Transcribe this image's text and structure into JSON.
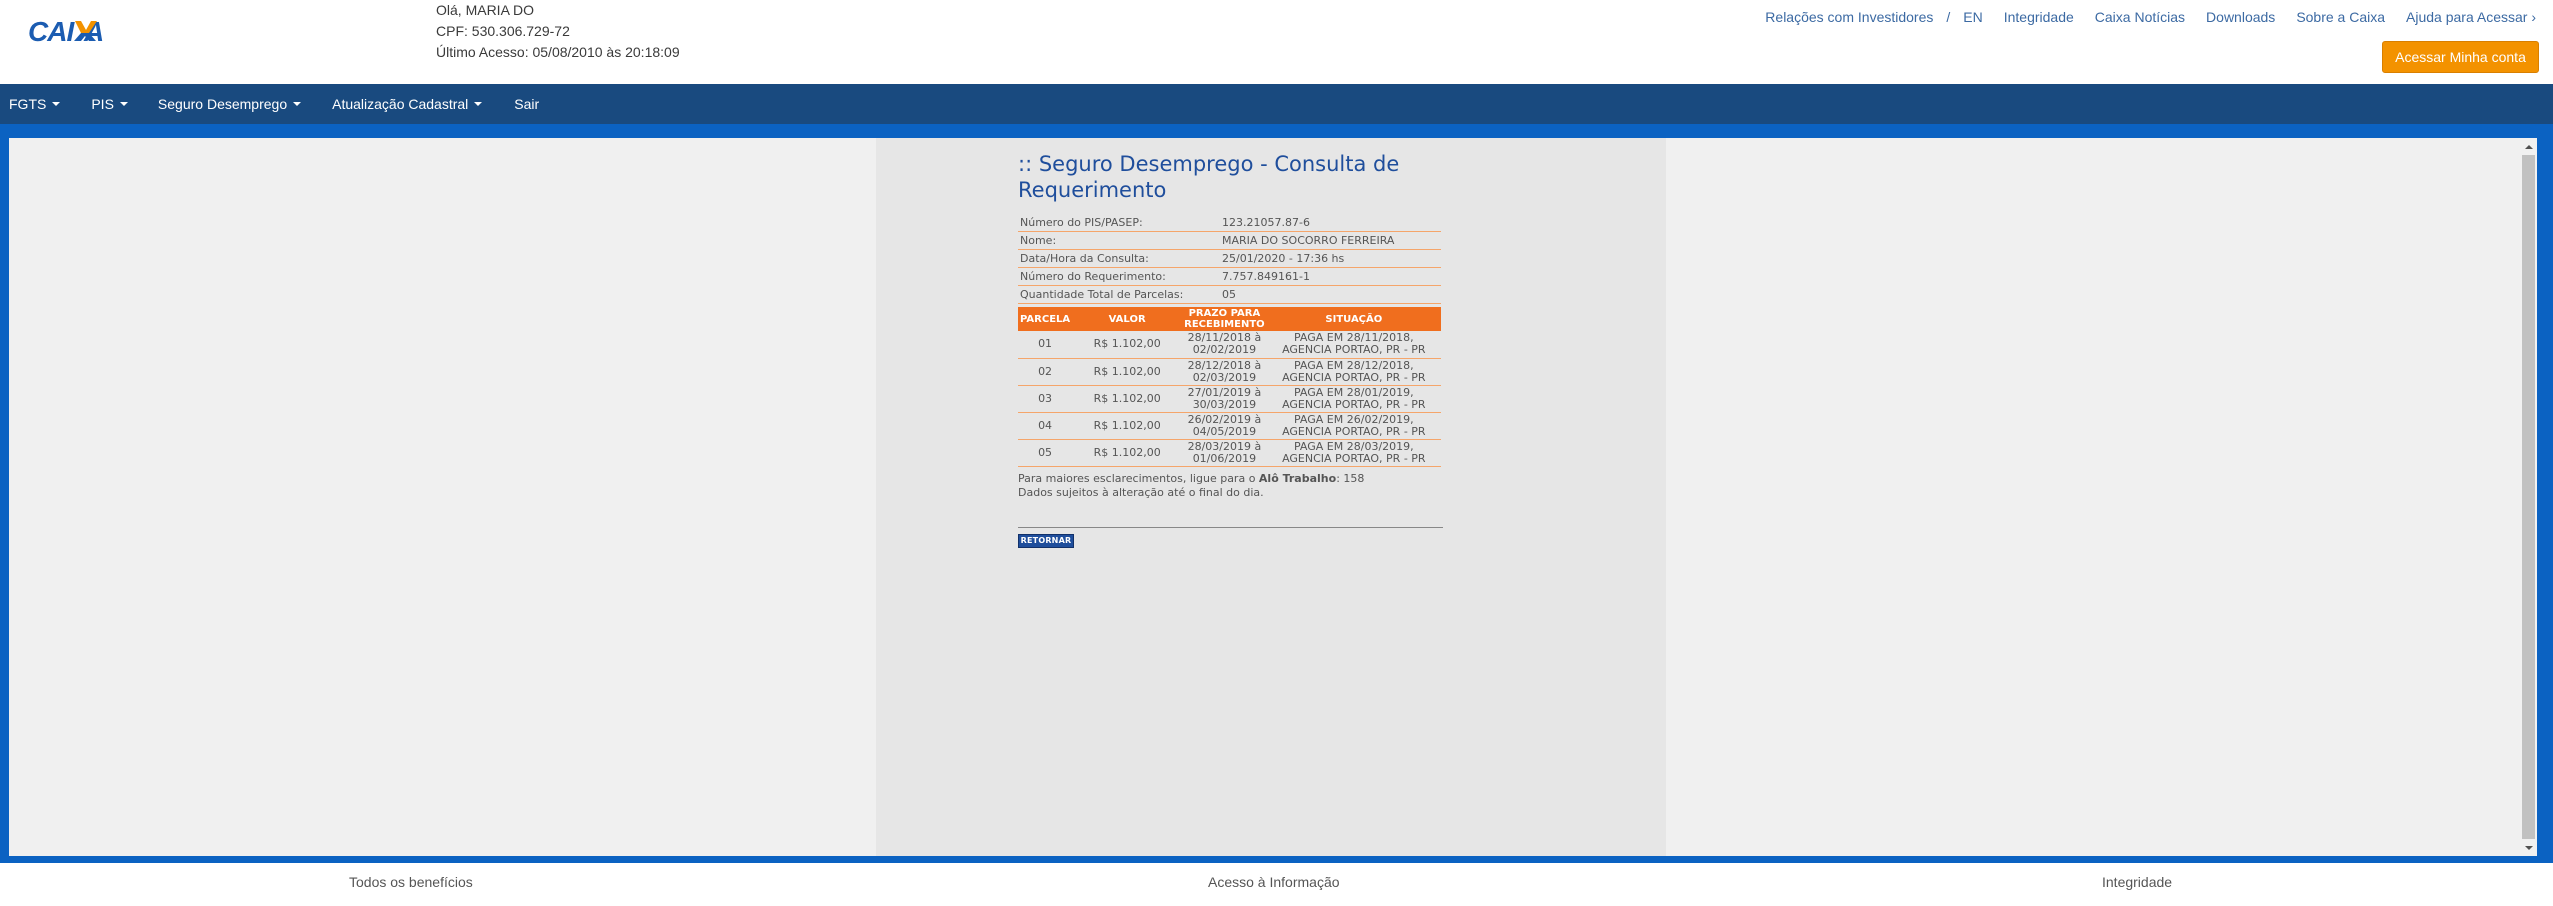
{
  "header": {
    "logo_text": "CAIXA",
    "greeting": "Olá, MARIA DO",
    "cpf": "CPF: 530.306.729-72",
    "last_access": "Último Acesso: 05/08/2010 às 20:18:09",
    "links": [
      {
        "label": "Relações com Investidores"
      },
      {
        "label": "EN"
      },
      {
        "label": "Integridade"
      },
      {
        "label": "Caixa Notícias"
      },
      {
        "label": "Downloads"
      },
      {
        "label": "Sobre a Caixa"
      },
      {
        "label": "Ajuda para Acessar ›"
      }
    ],
    "link_separator": "/",
    "access_button": "Acessar Minha conta"
  },
  "nav": {
    "items": [
      {
        "label": "FGTS",
        "dropdown": true
      },
      {
        "label": "PIS",
        "dropdown": true
      },
      {
        "label": "Seguro Desemprego",
        "dropdown": true
      },
      {
        "label": "Atualização Cadastral",
        "dropdown": true
      },
      {
        "label": "Sair",
        "dropdown": false
      }
    ]
  },
  "content": {
    "title": ":: Seguro Desemprego - Consulta de Requerimento",
    "info": [
      {
        "label": "Número do PIS/PASEP:",
        "value": "123.21057.87-6"
      },
      {
        "label": "Nome:",
        "value": "MARIA DO SOCORRO FERREIRA"
      },
      {
        "label": "Data/Hora da Consulta:",
        "value": "25/01/2020 - 17:36 hs"
      },
      {
        "label": "Número do Requerimento:",
        "value": "7.757.849161-1"
      },
      {
        "label": "Quantidade Total de Parcelas:",
        "value": "05"
      }
    ],
    "table": {
      "headers": [
        "PARCELA",
        "VALOR",
        "PRAZO PARA RECEBIMENTO",
        "SITUAÇÃO"
      ],
      "rows": [
        [
          "01",
          "R$ 1.102,00",
          "28/11/2018 à 02/02/2019",
          "PAGA EM 28/11/2018, AGENCIA PORTAO, PR - PR"
        ],
        [
          "02",
          "R$ 1.102,00",
          "28/12/2018 à 02/03/2019",
          "PAGA EM 28/12/2018, AGENCIA PORTAO, PR - PR"
        ],
        [
          "03",
          "R$ 1.102,00",
          "27/01/2019 à 30/03/2019",
          "PAGA EM 28/01/2019, AGENCIA PORTAO, PR - PR"
        ],
        [
          "04",
          "R$ 1.102,00",
          "26/02/2019 à 04/05/2019",
          "PAGA EM 26/02/2019, AGENCIA PORTAO, PR - PR"
        ],
        [
          "05",
          "R$ 1.102,00",
          "28/03/2019 à 01/06/2019",
          "PAGA EM 28/03/2019, AGENCIA PORTAO, PR - PR"
        ]
      ]
    },
    "note_prefix": "Para maiores esclarecimentos, ligue para o ",
    "note_bold": "Alô Trabalho",
    "note_suffix": ": 158",
    "note_2": "Dados sujeitos à alteração até o final do dia.",
    "return_button": "RETORNAR"
  },
  "footer": {
    "links": [
      {
        "label": "Todos os benefícios"
      },
      {
        "label": "Acesso à Informação"
      },
      {
        "label": "Integridade"
      }
    ]
  },
  "colors": {
    "nav_bg": "#194a7f",
    "frame_blue": "#0b62c2",
    "orange_button": "#f39200",
    "table_header": "#f06e1e",
    "title_blue": "#1f4e9c",
    "link_blue": "#3c6aa3"
  }
}
